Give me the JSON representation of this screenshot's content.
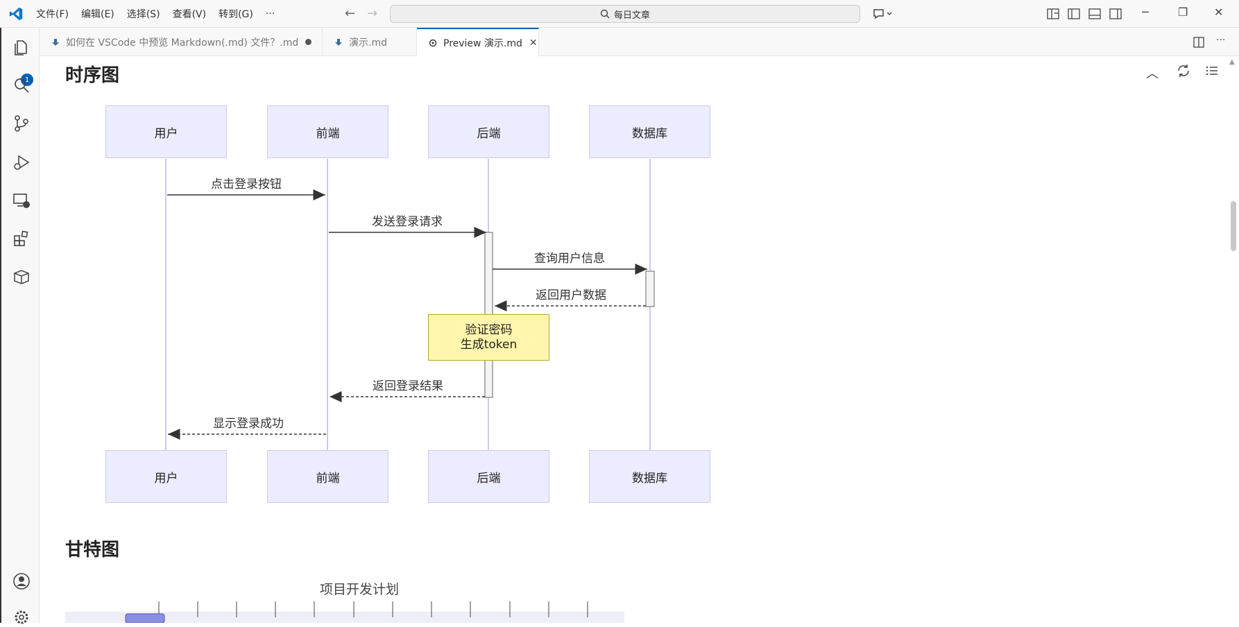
{
  "menu": {
    "file": "文件(F)",
    "edit": "编辑(E)",
    "select": "选择(S)",
    "view": "查看(V)",
    "goto": "转到(G)",
    "more": "···"
  },
  "search": {
    "text": "每日文章"
  },
  "activity": {
    "explorer_badge": "1"
  },
  "tabs": [
    {
      "label": "如何在 VSCode 中预览 Markdown(.md) 文件？.md",
      "modified": true
    },
    {
      "label": "演示.md"
    },
    {
      "label": "Preview 演示.md",
      "active": true,
      "close": "✕"
    }
  ],
  "preview": {
    "section1_title": "时序图",
    "section2_title": "甘特图",
    "gantt_title": "项目开发计划"
  },
  "sequence": {
    "actors": [
      "用户",
      "前端",
      "后端",
      "数据库"
    ],
    "messages": [
      "点击登录按钮",
      "发送登录请求",
      "查询用户信息",
      "返回用户数据",
      "返回登录结果",
      "显示登录成功"
    ],
    "note_line1": "验证密码",
    "note_line2": "生成token"
  },
  "colors": {
    "accent": "#005fb8",
    "actor_fill": "#ececff",
    "note_fill": "#fff5ad"
  },
  "icons": [
    "vscode-logo-icon",
    "explorer-icon",
    "search-icon",
    "source-control-icon",
    "run-debug-icon",
    "remote-explorer-icon",
    "extensions-icon",
    "containers-icon",
    "account-icon",
    "settings-icon"
  ]
}
